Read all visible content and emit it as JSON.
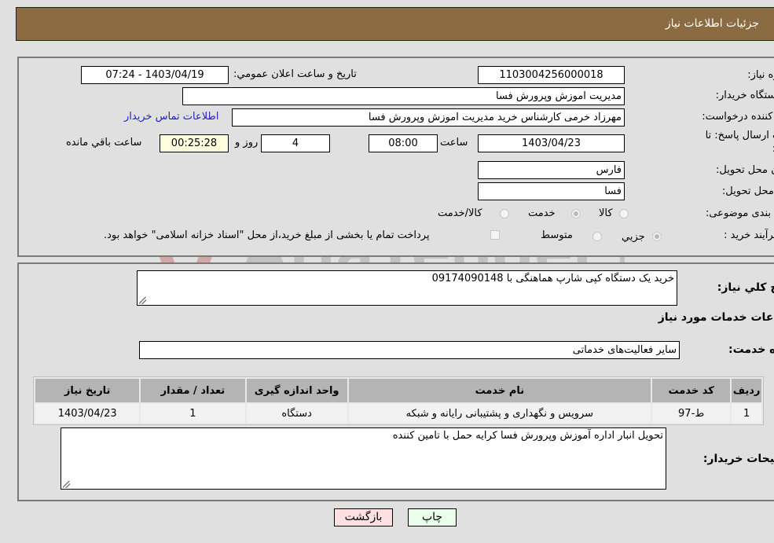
{
  "header": {
    "title": "جزئیات اطلاعات نیاز"
  },
  "info": {
    "need_number_label": "شماره نیاز:",
    "need_number": "1103004256000018",
    "announce_label": "تاريخ و ساعت اعلان عمومي:",
    "announce_value": "1403/04/19 - 07:24",
    "buyer_org_label": "نام دستگاه خريدار:",
    "buyer_org": "مديريت اموزش وپرورش فسا",
    "creator_label": "ايجاد کننده درخواست:",
    "creator": "مهرزاد خرمی کارشناس خرید مدیریت اموزش وپرورش فسا",
    "contact_link": "اطلاعات تماس خريدار",
    "deadline_label": "مهلت ارسال پاسخ: تا تاريخ:",
    "deadline_date": "1403/04/23",
    "time_label": "ساعت",
    "deadline_time": "08:00",
    "days_value": "4",
    "days_label": "روز و",
    "remaining_time": "00:25:28",
    "remaining_label": "ساعت باقي مانده",
    "province_label": "استان محل تحويل:",
    "province": "فارس",
    "city_label": "شهر محل تحويل:",
    "city": "فسا",
    "category_label": "طبقه بندی موضوعی:",
    "category_options": [
      {
        "label": "کالا",
        "checked": false
      },
      {
        "label": "خدمت",
        "checked": true
      },
      {
        "label": "کالا/خدمت",
        "checked": false
      }
    ],
    "process_label": "نوع فرآيند خريد :",
    "process_options": [
      {
        "label": "جزيي",
        "checked": true
      },
      {
        "label": "متوسط",
        "checked": false
      }
    ],
    "treasury_note": "پرداخت تمام يا بخشی از مبلغ خريد،از محل \"اسناد خزانه اسلامی\" خواهد بود."
  },
  "details": {
    "summary_label": "شرح کلي نياز:",
    "summary": "خرید یک دستگاه کپی شارپ هماهنگی با 09174090148",
    "services_title": "اطلاعات خدمات مورد نياز",
    "service_group_label": "گروه خدمت:",
    "service_group": "ساير فعاليت‌هاى خدماتى",
    "table": {
      "headers": [
        "رديف",
        "کد خدمت",
        "نام خدمت",
        "واحد اندازه گيری",
        "تعداد / مقدار",
        "تاريخ نياز"
      ],
      "rows": [
        [
          "1",
          "ط-97",
          "سرويس و نگهداری و پشتيبانی رايانه و شبکه",
          "دستگاه",
          "1",
          "1403/04/23"
        ]
      ]
    },
    "buyer_notes_label": "توضيحات خريدار:",
    "buyer_notes": "تحویل انبار اداره آموزش وپرورش فسا کرایه حمل با تامین کننده"
  },
  "buttons": {
    "print": "چاپ",
    "back": "بازگشت"
  },
  "colors": {
    "header_bg": "#8b6b42",
    "print_bg": "#eaffea",
    "back_bg": "#ffe0e0",
    "link": "#2222cc"
  },
  "watermark": {
    "text": "AriaTender.neT"
  }
}
